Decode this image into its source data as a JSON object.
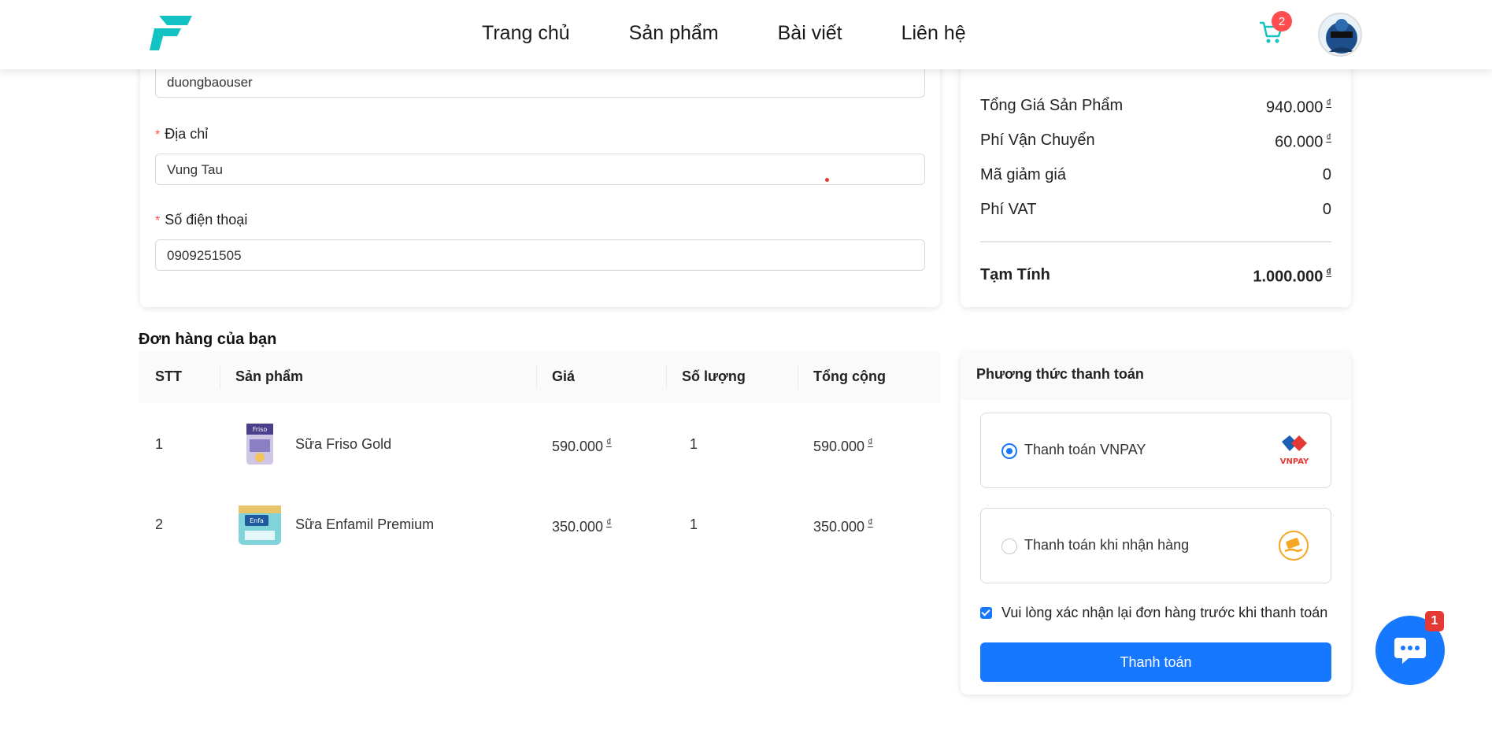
{
  "header": {
    "nav": [
      "Trang chủ",
      "Sản phẩm",
      "Bài viết",
      "Liên hệ"
    ],
    "cart_count": "2"
  },
  "form": {
    "username_value": "duongbaouser",
    "address_label": "Địa chỉ",
    "address_value": "Vung Tau",
    "phone_label": "Số điện thoại",
    "phone_value": "0909251505"
  },
  "summary": {
    "rows": [
      {
        "label": "Tổng Giá Sản Phẩm",
        "value": "940.000"
      },
      {
        "label": "Phí Vận Chuyển",
        "value": "60.000"
      },
      {
        "label": "Mã giảm giá",
        "value": "0"
      },
      {
        "label": "Phí VAT",
        "value": "0"
      }
    ],
    "total_label": "Tạm Tính",
    "total_value": "1.000.000",
    "currency": "₫"
  },
  "orders": {
    "title": "Đơn hàng của bạn",
    "columns": [
      "STT",
      "Sản phẩm",
      "Giá",
      "Số lượng",
      "Tổng cộng"
    ],
    "rows": [
      {
        "stt": "1",
        "product": "Sữa Friso Gold",
        "price": "590.000",
        "qty": "1",
        "total": "590.000"
      },
      {
        "stt": "2",
        "product": "Sữa Enfamil Premium",
        "price": "350.000",
        "qty": "1",
        "total": "350.000"
      }
    ]
  },
  "payment": {
    "title": "Phương thức thanh toán",
    "options": [
      {
        "label": "Thanh toán VNPAY",
        "logo": "VNPAY",
        "selected": true
      },
      {
        "label": "Thanh toán khi nhận hàng",
        "logo": "cod-icon",
        "selected": false
      }
    ],
    "confirm_label": "Vui lòng xác nhận lại đơn hàng trước khi thanh toán",
    "button_label": "Thanh toán"
  },
  "chat": {
    "badge": "1"
  },
  "colors": {
    "primary": "#1677ff",
    "accent": "#13c2c2",
    "danger": "#ff4d4f"
  }
}
